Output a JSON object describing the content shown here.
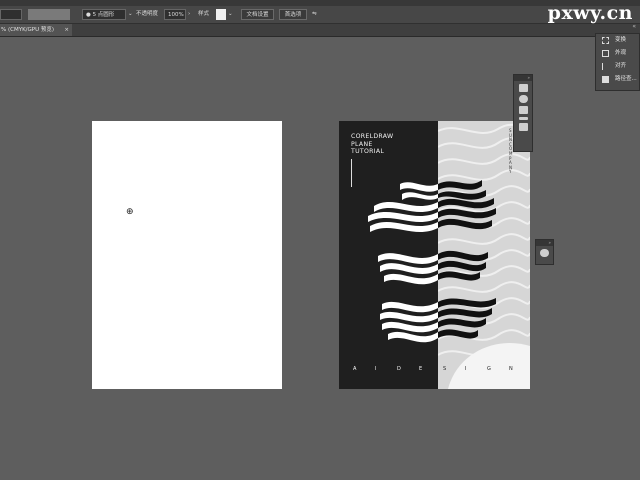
{
  "menubar": {
    "items": [
      "",
      "",
      "",
      "",
      "",
      "",
      "",
      ""
    ]
  },
  "control_bar": {
    "stroke_label": "5 点圆形",
    "opacity_label": "不透明度",
    "opacity_value": "100%",
    "style_label": "样式",
    "doc_setup_label": "文档设置",
    "prefs_label": "首选项"
  },
  "tab": {
    "title": "% (CMYK/GPU 预览)",
    "close": "×",
    "collapse": "«"
  },
  "poster": {
    "title_lines": [
      "CORELDRAW",
      "PLANE",
      "TUTORIAL"
    ],
    "side_text": "S U N C O M P A N Y",
    "letters": [
      "A",
      "I",
      "D",
      "E",
      "S",
      "I",
      "G",
      "N"
    ]
  },
  "right_panel": {
    "items": [
      "变换",
      "外观",
      "对齐",
      "路径查..."
    ]
  },
  "watermark": "pxwy.cn",
  "colors": {
    "bg": "#5e5e5e",
    "ctrlbar": "#474747",
    "poster_dark": "#1f1f1f",
    "poster_light": "#d6d6d6"
  }
}
